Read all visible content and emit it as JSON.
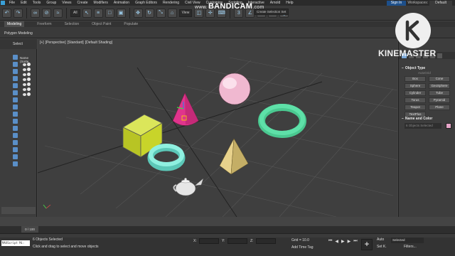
{
  "menu": {
    "items": [
      "File",
      "Edit",
      "Tools",
      "Group",
      "Views",
      "Create",
      "Modifiers",
      "Animation",
      "Graph Editors",
      "Rendering",
      "Civil View",
      "Customize",
      "Scripting",
      "Interactive",
      "Arnold",
      "Help"
    ],
    "sign_in": "Sign In",
    "workspaces_label": "Workspaces:",
    "workspace_value": "Default"
  },
  "toolbar": {
    "filter_value": "All",
    "view_value": "View",
    "selection_set_placeholder": "Create Selection Set"
  },
  "ribbon": {
    "tabs": [
      "Modeling",
      "Freeform",
      "Selection",
      "Object Paint",
      "Populate"
    ],
    "active_tab": "Modeling",
    "subpanel": "Polygon Modeling"
  },
  "scene_explorer": {
    "tab_label": "Select",
    "column_header": "Name (Sorte"
  },
  "viewport": {
    "label_parts": [
      "[+]",
      "[Perspective]",
      "[Standard]",
      "[Default Shading]"
    ]
  },
  "command_panel": {
    "section_object_type": "Object Type",
    "autogrid": "AutoGrid",
    "primitives": [
      "Box",
      "Cone",
      "Sphere",
      "GeoSphere",
      "Cylinder",
      "Tube",
      "Torus",
      "Pyramid",
      "Teapot",
      "Plane",
      "TextPlus"
    ],
    "section_name_color": "Name and Color",
    "object_name_placeholder": "6 Objects Selected",
    "object_color": "#e6a5c8"
  },
  "timeline": {
    "frame_display": "0 / 100"
  },
  "status": {
    "maxscript": "MAXScript Mi:",
    "selection_info": "6 Objects Selected",
    "prompt": "Click and drag to select and move objects",
    "x_label": "X:",
    "y_label": "Y:",
    "z_label": "Z:",
    "grid": "Grid = 10.0",
    "add_time_tag": "Add Time Tag",
    "auto_label": "Auto",
    "set_key_label": "Set K.",
    "selected_dropdown": "Selected",
    "filters": "Filters..."
  },
  "watermarks": {
    "bandicam_prefix": "www.",
    "bandicam": "BANDICAM",
    "bandicam_suffix": ".com",
    "kinemaster": "KINEMASTER"
  },
  "colors": {
    "accent_blue": "#4f8ec8",
    "viewport_bg": "#3f3f3f",
    "box_color": "#c8d42a",
    "cone_color": "#e0348c",
    "sphere_color": "#f0b8d0",
    "torus_color": "#5ee0a8",
    "tube_color": "#7fe8d8",
    "pyramid_color": "#d8c27a",
    "teapot_color": "#e6e6e6"
  }
}
